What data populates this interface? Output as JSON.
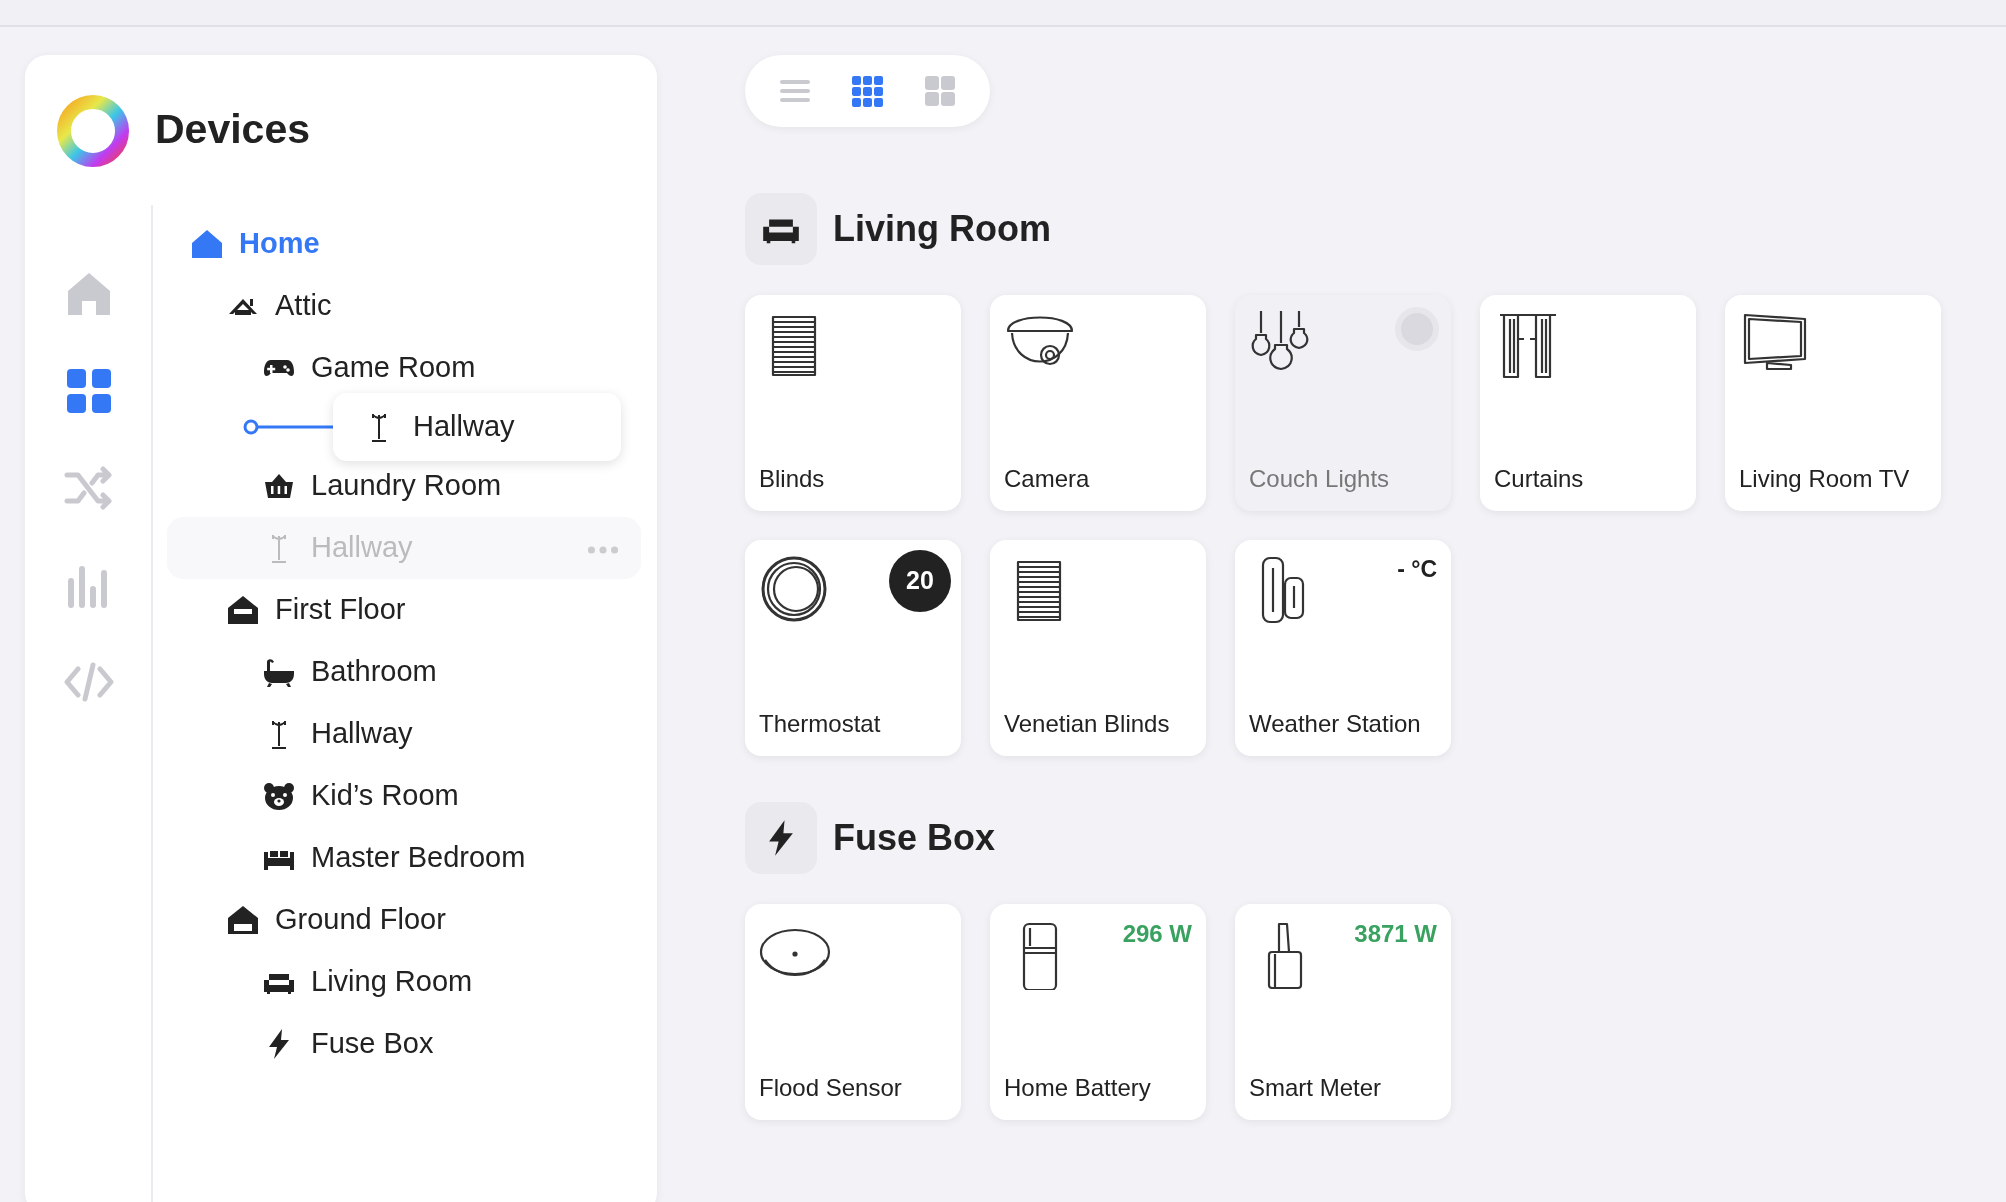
{
  "app": {
    "title": "Devices"
  },
  "rail": [
    {
      "kind": "home",
      "selected": false
    },
    {
      "kind": "grid",
      "selected": true
    },
    {
      "kind": "shuffle",
      "selected": false
    },
    {
      "kind": "chart",
      "selected": false
    },
    {
      "kind": "code",
      "selected": false
    }
  ],
  "tree": [
    {
      "kind": "home",
      "label": "Home",
      "selected": true,
      "dragging": false,
      "children": [
        {
          "kind": "attic",
          "label": "Attic",
          "selected": false,
          "dragging": false,
          "children": [
            {
              "kind": "gamepad",
              "label": "Game Room",
              "selected": false,
              "dragging": false
            },
            {
              "kind": "drop-indicator",
              "label": "Hallway"
            },
            {
              "kind": "basket",
              "label": "Laundry Room",
              "selected": false,
              "dragging": false
            },
            {
              "kind": "coatrack",
              "label": "Hallway",
              "selected": false,
              "dragging": true
            }
          ]
        },
        {
          "kind": "floor1",
          "label": "First Floor",
          "selected": false,
          "dragging": false,
          "children": [
            {
              "kind": "bath",
              "label": "Bathroom",
              "selected": false,
              "dragging": false
            },
            {
              "kind": "coatrack",
              "label": "Hallway",
              "selected": false,
              "dragging": false
            },
            {
              "kind": "bear",
              "label": "Kid’s Room",
              "selected": false,
              "dragging": false
            },
            {
              "kind": "bed",
              "label": "Master Bedroom",
              "selected": false,
              "dragging": false
            }
          ]
        },
        {
          "kind": "floor0",
          "label": "Ground Floor",
          "selected": false,
          "dragging": false,
          "children": [
            {
              "kind": "sofa",
              "label": "Living Room",
              "selected": false,
              "dragging": false
            },
            {
              "kind": "bolt",
              "label": "Fuse Box",
              "selected": false,
              "dragging": false
            }
          ]
        }
      ]
    }
  ],
  "view_modes": [
    {
      "kind": "list",
      "selected": false
    },
    {
      "kind": "small-grid",
      "selected": true
    },
    {
      "kind": "large-grid",
      "selected": false
    }
  ],
  "sections": [
    {
      "kind": "sofa",
      "title": "Living Room",
      "devices": [
        {
          "kind": "blinds",
          "name": "Blinds",
          "disabled": false
        },
        {
          "kind": "camera",
          "name": "Camera",
          "disabled": false
        },
        {
          "kind": "bulbs",
          "name": "Couch Lights",
          "disabled": true,
          "on": false
        },
        {
          "kind": "curtains",
          "name": "Curtains",
          "disabled": false
        },
        {
          "kind": "tv",
          "name": "Living Room TV",
          "disabled": false
        },
        {
          "kind": "thermostat",
          "name": "Thermostat",
          "disabled": false,
          "reading": {
            "kind": "badge",
            "text": "20"
          }
        },
        {
          "kind": "blinds",
          "name": "Venetian Blinds",
          "disabled": false
        },
        {
          "kind": "weather",
          "name": "Weather Station",
          "disabled": false,
          "reading": {
            "kind": "plain",
            "text": "- °C"
          }
        }
      ]
    },
    {
      "kind": "bolt",
      "title": "Fuse Box",
      "devices": [
        {
          "kind": "flood",
          "name": "Flood Sensor",
          "disabled": false
        },
        {
          "kind": "battery",
          "name": "Home Battery",
          "disabled": false,
          "reading": {
            "kind": "power",
            "text": "296 W"
          }
        },
        {
          "kind": "meter",
          "name": "Smart Meter",
          "disabled": false,
          "reading": {
            "kind": "power",
            "text": "3871 W"
          }
        }
      ]
    }
  ]
}
